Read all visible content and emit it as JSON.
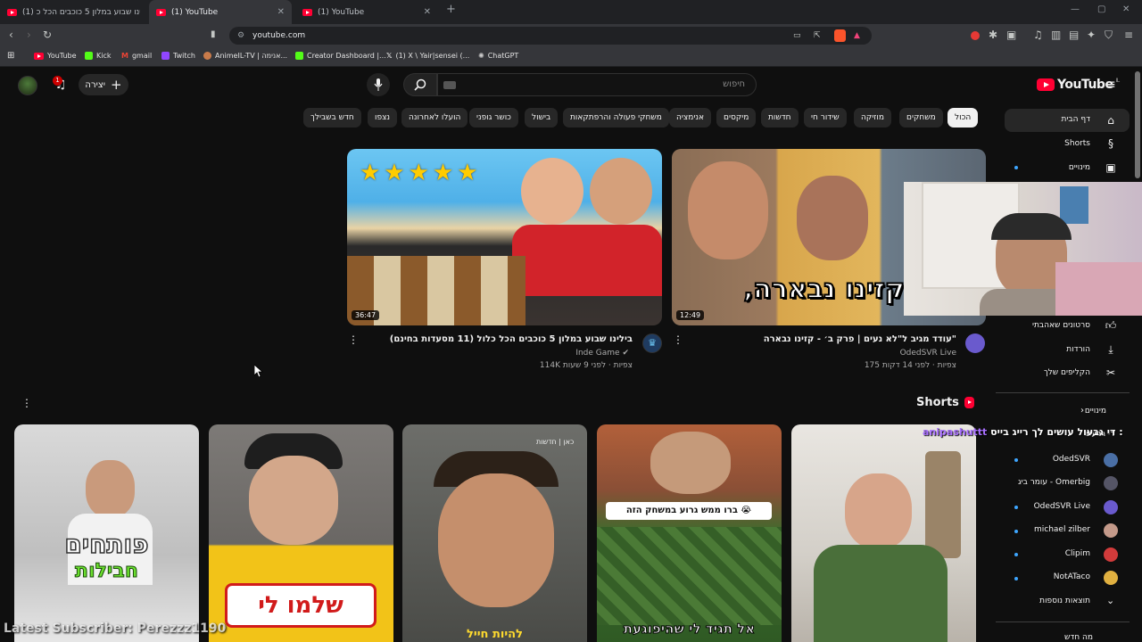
{
  "browser": {
    "tabs": [
      {
        "title": "(1) בילינו שבוע במלון 5 כוכבים הכל כ..."
      },
      {
        "title": "(1) YouTube"
      },
      {
        "title": "(1) YouTube"
      }
    ],
    "url": "youtube.com",
    "bookmarks": [
      "YouTube",
      "Kick",
      "gmail",
      "Twitch",
      "AnimeIL-TV | אנימה...",
      "Creator Dashboard |...",
      "(1) X \\ Yair|sensei (...",
      "ChatGPT"
    ]
  },
  "masthead": {
    "search_placeholder": "חיפוש",
    "create_label": "יצירה",
    "notification_count": "1",
    "logo_text": "YouTube",
    "logo_country": "IL"
  },
  "chips": [
    "הכול",
    "משחקים",
    "מוזיקה",
    "שידור חי",
    "חדשות",
    "מיקסים",
    "אנימציה",
    "משחקי פעולה והרפתקאות",
    "בישול",
    "כושר גופני",
    "הועלו לאחרונה",
    "נצפו",
    "חדש בשבילך"
  ],
  "sidebar": {
    "items": [
      {
        "label": "דף הבית",
        "icon": "home-icon"
      },
      {
        "label": "Shorts",
        "icon": "shorts-icon"
      },
      {
        "label": "מינויים",
        "icon": "subscriptions-icon"
      },
      {
        "label": "סרטונים שאהבתי",
        "icon": "like-icon"
      },
      {
        "label": "הורדות",
        "icon": "download-icon"
      },
      {
        "label": "הקליפים שלך",
        "icon": "scissors-icon"
      }
    ],
    "subs_heading": "מינויים",
    "subs_partial": "די גבעול",
    "channels": [
      {
        "name": "OdedSVR",
        "color": "#4a6fa5"
      },
      {
        "name": "עומר ביג - Omerbig",
        "color": "#555566"
      },
      {
        "name": "OdedSVR Live",
        "color": "#6a5acd"
      },
      {
        "name": "michael zilber",
        "color": "#c49a8a"
      },
      {
        "name": "Clipim",
        "color": "#d23b3b"
      },
      {
        "name": "NotATaco",
        "color": "#e0b040"
      }
    ],
    "show_more": "תוצאות נוספות",
    "footer_partial": "מה חדש"
  },
  "videos": [
    {
      "title": "בילינו שבוע במלון 5 כוכבים הכל כלול (11 מסעדות בחינם)",
      "channel": "Inde Game",
      "verified": true,
      "meta": "114K צפיות · לפני 9 שעות",
      "duration": "36:47"
    },
    {
      "title": "עודד מגיב ל\"לא נעים | פרק ב׳ - קזינו נבארה\"",
      "channel": "OdedSVR Live",
      "verified": false,
      "meta": "175 צפיות · לפני 14 דקות",
      "duration": "12:49",
      "overlay": "‚קזינו נבארה‘"
    }
  ],
  "shorts": {
    "heading": "Shorts",
    "items": [
      {
        "overlay_top": "פותחים",
        "overlay_bottom": "חבילות"
      },
      {
        "overlay": "שלמו לי"
      },
      {
        "overlay": "להיות חייל",
        "badge": "כאן | חדשות"
      },
      {
        "caption": "ברו ממש גרוע במשחק הזה 😭",
        "overlay": "אל תגיד לי שהיפוגעת"
      },
      {}
    ]
  },
  "stream_overlay": {
    "latest_subscriber": "Latest Subscriber: Perezzz1190",
    "chat_user": "anipashuttt",
    "chat_message": "די גבעול עושים לך רייג בייס :"
  }
}
